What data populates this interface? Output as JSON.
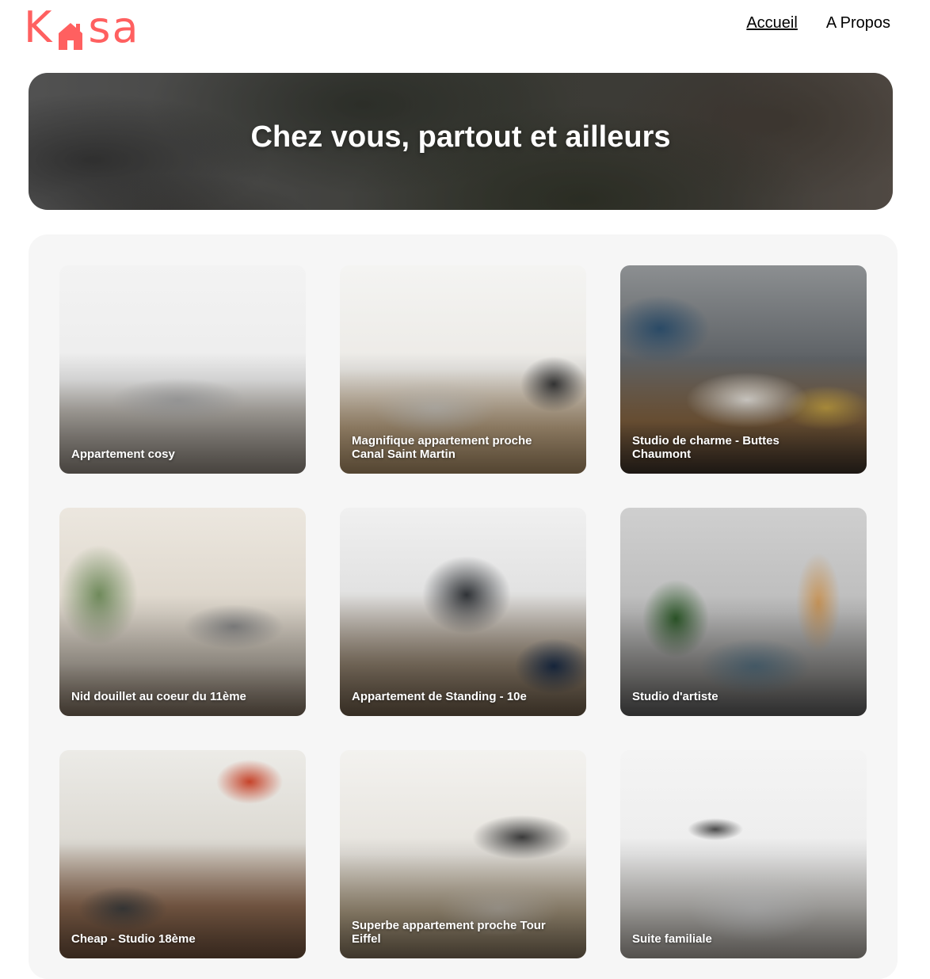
{
  "header": {
    "logo": {
      "before": "K",
      "after": "sa",
      "color": "#FF6060",
      "icon": "house-icon"
    },
    "nav": [
      {
        "label": "Accueil",
        "active": true
      },
      {
        "label": "A Propos",
        "active": false
      }
    ]
  },
  "banner": {
    "title": "Chez vous, partout et ailleurs"
  },
  "gallery": {
    "cards": [
      {
        "title": "Appartement cosy"
      },
      {
        "title": "Magnifique appartement proche Canal Saint Martin"
      },
      {
        "title": "Studio de charme - Buttes Chaumont"
      },
      {
        "title": "Nid douillet au coeur du 11ème"
      },
      {
        "title": "Appartement de Standing - 10e"
      },
      {
        "title": "Studio d'artiste"
      },
      {
        "title": "Cheap - Studio 18ème"
      },
      {
        "title": "Superbe appartement proche Tour Eiffel"
      },
      {
        "title": "Suite familiale"
      }
    ]
  }
}
